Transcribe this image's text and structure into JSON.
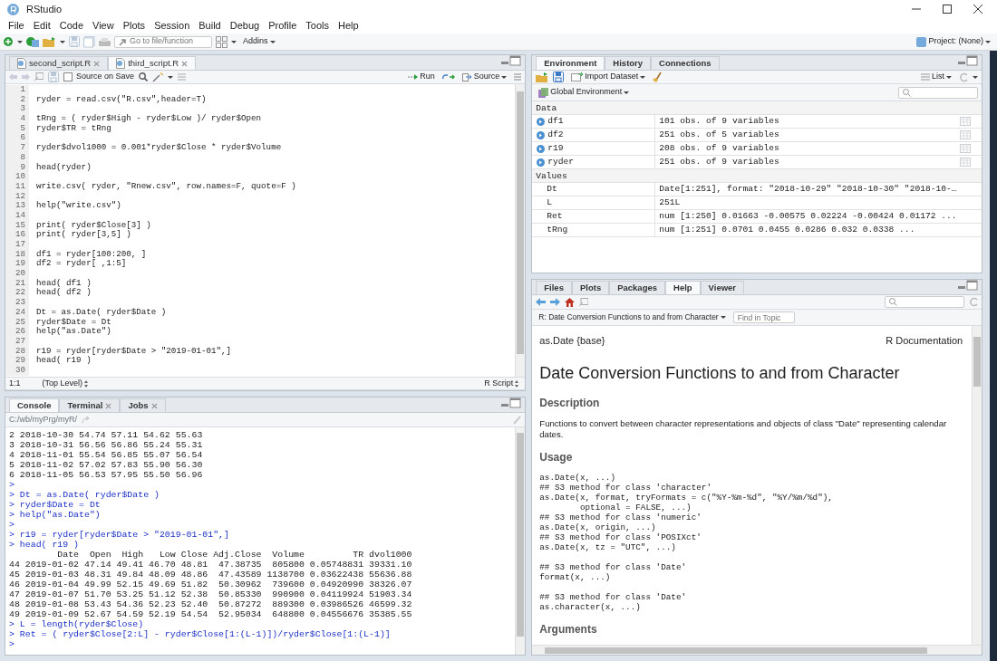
{
  "window": {
    "title": "RStudio"
  },
  "menu": [
    "File",
    "Edit",
    "Code",
    "View",
    "Plots",
    "Session",
    "Build",
    "Debug",
    "Profile",
    "Tools",
    "Help"
  ],
  "toolbar": {
    "goto_placeholder": "Go to file/function",
    "addins": "Addins",
    "project": "Project: (None)"
  },
  "editor": {
    "tabs": [
      {
        "label": "second_script.R",
        "selected": false
      },
      {
        "label": "third_script.R",
        "selected": true
      }
    ],
    "source_on_save": {
      "label": "Source on Save",
      "checked": false
    },
    "run": "Run",
    "source": "Source",
    "lines": [
      {
        "number": "1"
      },
      {
        "number": "2",
        "code": "ryder = read.csv(\"R.csv\",header=T)"
      },
      {
        "number": "3"
      },
      {
        "number": "4",
        "code": "tRng = ( ryder$High - ryder$Low )/ ryder$Open"
      },
      {
        "number": "5",
        "code": "ryder$TR = tRng"
      },
      {
        "number": "6"
      },
      {
        "number": "7",
        "code": "ryder$dvol1000 = 0.001*ryder$Close * ryder$Volume"
      },
      {
        "number": "8"
      },
      {
        "number": "9",
        "code": "head(ryder)"
      },
      {
        "number": "10"
      },
      {
        "number": "11",
        "code": "write.csv( ryder, \"Rnew.csv\", row.names=F, quote=F )"
      },
      {
        "number": "12"
      },
      {
        "number": "13",
        "code": "help(\"write.csv\")"
      },
      {
        "number": "14"
      },
      {
        "number": "15",
        "code": "print( ryder$Close[3] )"
      },
      {
        "number": "16",
        "code": "print( ryder[3,5] )"
      },
      {
        "number": "17"
      },
      {
        "number": "18",
        "code": "df1 = ryder[100:200, ]"
      },
      {
        "number": "19",
        "code": "df2 = ryder[ ,1:5]"
      },
      {
        "number": "20"
      },
      {
        "number": "21",
        "code": "head( df1 )"
      },
      {
        "number": "22",
        "code": "head( df2 )"
      },
      {
        "number": "23"
      },
      {
        "number": "24",
        "code": "Dt = as.Date( ryder$Date )"
      },
      {
        "number": "25",
        "code": "ryder$Date = Dt"
      },
      {
        "number": "26",
        "code": "help(\"as.Date\")"
      },
      {
        "number": "27"
      },
      {
        "number": "28",
        "code": "r19 = ryder[ryder$Date > \"2019-01-01\",]"
      },
      {
        "number": "29",
        "code": "head( r19 )"
      },
      {
        "number": "30"
      }
    ],
    "status": {
      "position": "1:1",
      "scope": "(Top Level)",
      "file_type": "R Script"
    }
  },
  "console": {
    "tabs": [
      {
        "label": "Console",
        "selected": true,
        "closable": false
      },
      {
        "label": "Terminal",
        "selected": false,
        "closable": true
      },
      {
        "label": "Jobs",
        "selected": false,
        "closable": true
      }
    ],
    "path": "C:/wb/myPrg/myR/",
    "lines": [
      {
        "kind": "output",
        "text": "2 2018-10-30 54.74 57.11 54.62 55.63"
      },
      {
        "kind": "output",
        "text": "3 2018-10-31 56.56 56.86 55.24 55.31"
      },
      {
        "kind": "output",
        "text": "4 2018-11-01 55.54 56.85 55.07 56.54"
      },
      {
        "kind": "output",
        "text": "5 2018-11-02 57.02 57.83 55.90 56.30"
      },
      {
        "kind": "output",
        "text": "6 2018-11-05 56.53 57.95 55.50 56.96"
      },
      {
        "kind": "input",
        "text": ">"
      },
      {
        "kind": "input",
        "text": "> Dt = as.Date( ryder$Date )"
      },
      {
        "kind": "input",
        "text": "> ryder$Date = Dt"
      },
      {
        "kind": "input",
        "text": "> help(\"as.Date\")"
      },
      {
        "kind": "input",
        "text": ">"
      },
      {
        "kind": "input",
        "text": "> r19 = ryder[ryder$Date > \"2019-01-01\",]"
      },
      {
        "kind": "input",
        "text": "> head( r19 )"
      },
      {
        "kind": "output",
        "text": "         Date  Open  High   Low Close Adj.Close  Volume         TR dvol1000"
      },
      {
        "kind": "output",
        "text": "44 2019-01-02 47.14 49.41 46.70 48.81  47.38735  805800 0.05748831 39331.10"
      },
      {
        "kind": "output",
        "text": "45 2019-01-03 48.31 49.84 48.09 48.86  47.43589 1138700 0.03622438 55636.88"
      },
      {
        "kind": "output",
        "text": "46 2019-01-04 49.99 52.15 49.69 51.82  50.30962  739600 0.04920990 38326.07"
      },
      {
        "kind": "output",
        "text": "47 2019-01-07 51.70 53.25 51.12 52.38  50.85330  990900 0.04119924 51903.34"
      },
      {
        "kind": "output",
        "text": "48 2019-01-08 53.43 54.36 52.23 52.40  50.87272  889300 0.03986526 46599.32"
      },
      {
        "kind": "output",
        "text": "49 2019-01-09 52.67 54.59 52.19 54.54  52.95034  648800 0.04556676 35385.55"
      },
      {
        "kind": "input",
        "text": "> L = length(ryder$Close)"
      },
      {
        "kind": "input",
        "text": "> Ret = ( ryder$Close[2:L] - ryder$Close[1:(L-1)])/ryder$Close[1:(L-1)]"
      },
      {
        "kind": "input",
        "text": ">"
      }
    ]
  },
  "environment": {
    "tabs": [
      {
        "label": "Environment",
        "selected": true
      },
      {
        "label": "History",
        "selected": false
      },
      {
        "label": "Connections",
        "selected": false
      }
    ],
    "import": "Import Dataset",
    "view": "List",
    "scope": "Global Environment",
    "data_heading": "Data",
    "data": [
      {
        "name": "df1",
        "value": "101 obs. of 9 variables"
      },
      {
        "name": "df2",
        "value": "251 obs. of 5 variables"
      },
      {
        "name": "r19",
        "value": "208 obs. of 9 variables"
      },
      {
        "name": "ryder",
        "value": "251 obs. of 9 variables"
      }
    ],
    "values_heading": "Values",
    "values": [
      {
        "name": "Dt",
        "value": "Date[1:251], format: \"2018-10-29\" \"2018-10-30\" \"2018-10-…"
      },
      {
        "name": "L",
        "value": "251L"
      },
      {
        "name": "Ret",
        "value": "num [1:250] 0.01663 -0.00575 0.02224 -0.00424 0.01172 ..."
      },
      {
        "name": "tRng",
        "value": "num [1:251] 0.0701 0.0455 0.0286 0.032 0.0338 ..."
      }
    ]
  },
  "help": {
    "tabs": [
      {
        "label": "Files",
        "selected": false
      },
      {
        "label": "Plots",
        "selected": false
      },
      {
        "label": "Packages",
        "selected": false
      },
      {
        "label": "Help",
        "selected": true
      },
      {
        "label": "Viewer",
        "selected": false
      }
    ],
    "topic": "R: Date Conversion Functions to and from Character",
    "find_placeholder": "Find in Topic",
    "package": "as.Date {base}",
    "doc_label": "R Documentation",
    "title": "Date Conversion Functions to and from Character",
    "sections": [
      {
        "kind": "heading",
        "text": "Description"
      },
      {
        "kind": "paragraph",
        "text": "Functions to convert between character representations and objects of class \"Date\" representing calendar dates."
      },
      {
        "kind": "heading",
        "text": "Usage"
      },
      {
        "kind": "code",
        "text": "as.Date(x, ...)\n## S3 method for class 'character'\nas.Date(x, format, tryFormats = c(\"%Y-%m-%d\", \"%Y/%m/%d\"),\n        optional = FALSE, ...)\n## S3 method for class 'numeric'\nas.Date(x, origin, ...)\n## S3 method for class 'POSIXct'\nas.Date(x, tz = \"UTC\", ...)\n\n## S3 method for class 'Date'\nformat(x, ...)\n\n## S3 method for class 'Date'\nas.character(x, ...)"
      },
      {
        "kind": "heading",
        "text": "Arguments"
      }
    ]
  }
}
